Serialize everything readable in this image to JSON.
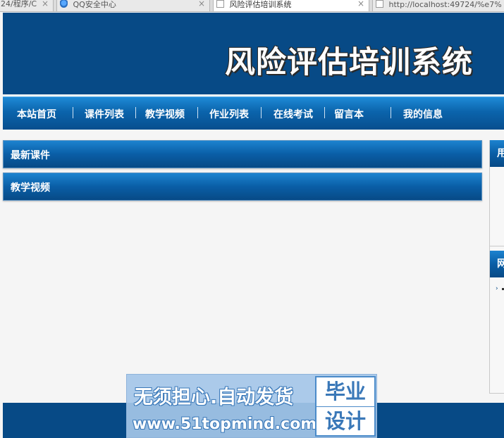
{
  "browser": {
    "tabs": [
      {
        "label": "24/程序/C",
        "active": false
      },
      {
        "label": "QQ安全中心",
        "active": false
      },
      {
        "label": "风险评估培训系统",
        "active": true
      },
      {
        "label": "http://localhost:49724/%e7%",
        "active": false
      }
    ],
    "close_glyph": "×"
  },
  "header": {
    "title": "风险评估培训系统",
    "bg_color": "#074a86"
  },
  "nav": {
    "items": [
      "本站首页",
      "课件列表",
      "教学视频",
      "作业列表",
      "在线考试",
      "留言本",
      "我的信息"
    ]
  },
  "main": {
    "panels": [
      {
        "title": "最新课件"
      },
      {
        "title": "教学视频"
      }
    ]
  },
  "sidebar": {
    "sections": [
      {
        "title": "用"
      },
      {
        "title": "网"
      }
    ],
    "link_arrow": "›"
  },
  "watermark": {
    "line1": "无须担心.自动发货",
    "line2": "www.51topmind.com",
    "badge_top": "毕业",
    "badge_bottom": "设计"
  },
  "colors": {
    "accent": "#074a86",
    "nav_light": "#1e8ad6",
    "background": "#f5f5f5"
  }
}
